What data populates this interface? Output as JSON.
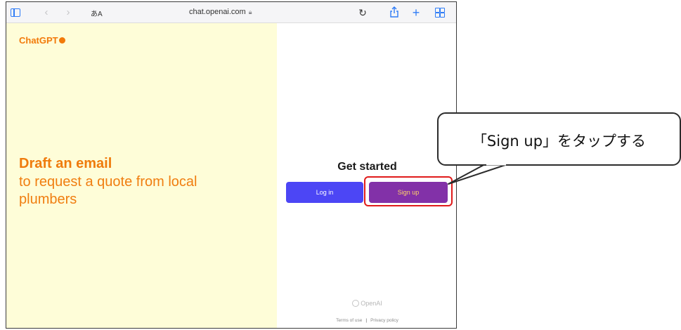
{
  "browser": {
    "text_size_label": "あA",
    "url": "chat.openai.com",
    "icons": [
      "sidebar-icon",
      "back-icon",
      "forward-icon",
      "lock-icon",
      "reload-icon",
      "share-icon",
      "new-tab-icon",
      "tabs-icon"
    ]
  },
  "left_panel": {
    "brand": "ChatGPT",
    "hero_title": "Draft an email",
    "hero_subtitle": "to request a quote from local plumbers",
    "background": "#fefdd8",
    "accent": "#f27a0a"
  },
  "right_panel": {
    "heading": "Get started",
    "login_label": "Log in",
    "signup_label": "Sign up",
    "login_color": "#4c46f5",
    "signup_color": "#8231a8",
    "openai_label": "OpenAI",
    "terms_label": "Terms of use",
    "separator": "|",
    "privacy_label": "Privacy policy"
  },
  "annotation": {
    "callout_text": "「Sign up」をタップする",
    "highlight_color": "#e01b1b"
  }
}
